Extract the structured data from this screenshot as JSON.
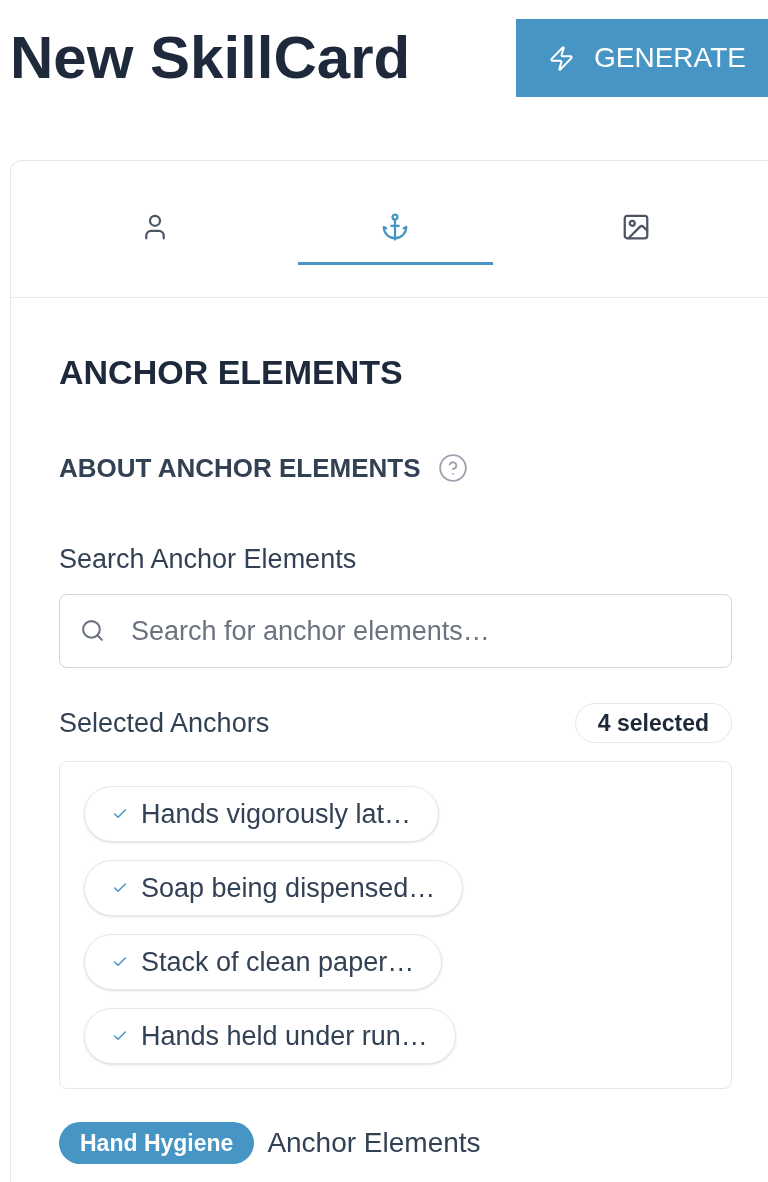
{
  "header": {
    "title": "New SkillCard",
    "generate_button": {
      "label": "GENERATE"
    }
  },
  "tabs": [
    {
      "kind": "person",
      "selected": false
    },
    {
      "kind": "anchor",
      "selected": true
    },
    {
      "kind": "image",
      "selected": false
    }
  ],
  "section": {
    "heading": "ANCHOR ELEMENTS",
    "about": {
      "label": "ABOUT ANCHOR ELEMENTS"
    },
    "search": {
      "label": "Search Anchor Elements",
      "placeholder": "Search for anchor elements…"
    },
    "selected_anchors": {
      "label": "Selected Anchors",
      "count": "4 selected",
      "items": [
        {
          "label": "Hands vigorously lat…",
          "checked": true
        },
        {
          "label": "Soap being dispensed…",
          "checked": true
        },
        {
          "label": "Stack of clean paper…",
          "checked": true
        },
        {
          "label": "Hands held under run…",
          "checked": true
        }
      ]
    },
    "category": {
      "tag": "Hand Hygiene",
      "label": "Anchor Elements"
    }
  }
}
